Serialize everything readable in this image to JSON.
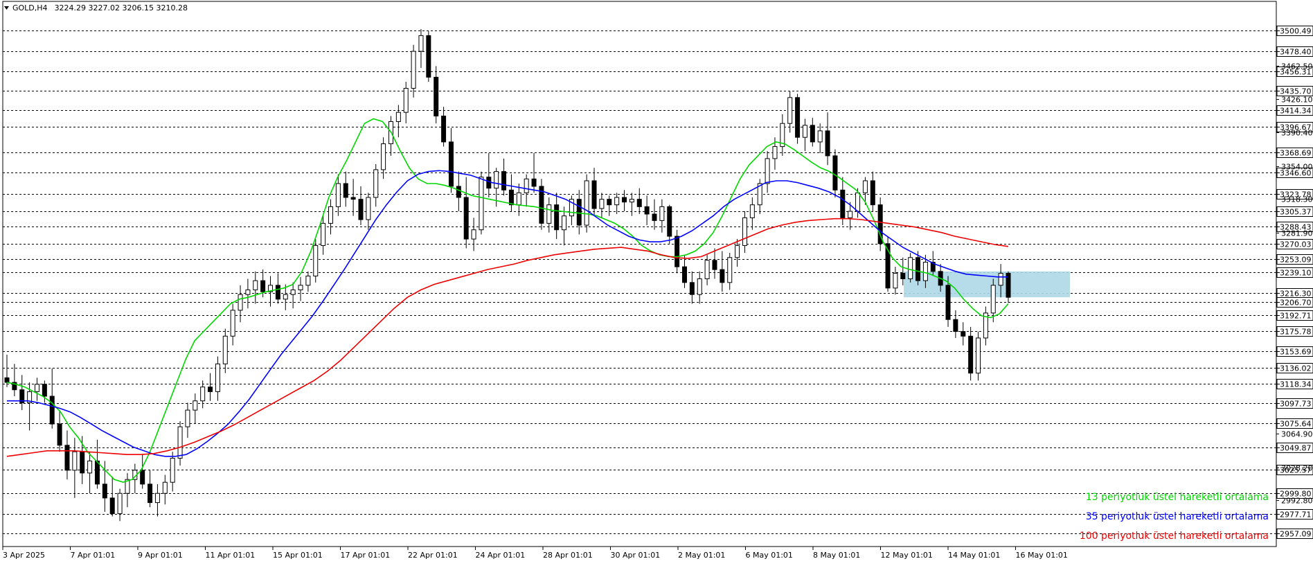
{
  "header": {
    "symbol": "GOLD,H4",
    "ohlc": "3224.29 3227.02 3206.15 3210.28"
  },
  "legend": [
    {
      "label": "13 periyotluk üstel hareketli ortalama",
      "color": "#00d800"
    },
    {
      "label": "35 periyotluk üstel hareketli ortalama",
      "color": "#0000ff"
    },
    {
      "label": "100 periyotluk üstel hareketli ortalama",
      "color": "#ee0000"
    }
  ],
  "price_axis": {
    "level_labels": [
      "3500.49",
      "3478.40",
      "3456.31",
      "3435.70",
      "3414.34",
      "3396.67",
      "3368.69",
      "3346.60",
      "3323.78",
      "3305.37",
      "3288.43",
      "3270.03",
      "3253.09",
      "3239.10",
      "3216.30",
      "3206.70",
      "3192.71",
      "3175.78",
      "3153.69",
      "3136.02",
      "3118.34",
      "3097.73",
      "3075.64",
      "3049.87",
      "3025.57",
      "2999.80",
      "2977.71",
      "2957.09"
    ],
    "tick_labels": [
      "3462.50",
      "3426.10",
      "3390.40",
      "3354.00",
      "3318.30",
      "3281.90",
      "3064.90",
      "3028.20",
      "2992.80"
    ]
  },
  "time_axis": {
    "labels": [
      "3 Apr 2025",
      "7 Apr 01:01",
      "9 Apr 01:01",
      "11 Apr 01:01",
      "15 Apr 01:01",
      "17 Apr 01:01",
      "22 Apr 01:01",
      "24 Apr 01:01",
      "28 Apr 01:01",
      "30 Apr 01:01",
      "2 May 01:01",
      "6 May 01:01",
      "8 May 01:01",
      "12 May 01:01",
      "14 May 01:01",
      "16 May 01:01"
    ]
  },
  "chart_data": {
    "type": "candlestick",
    "symbol": "GOLD",
    "timeframe": "H4",
    "ylim": [
      2950,
      3510
    ],
    "grid": "horizontal dashed lines at level labels",
    "zone": {
      "y_top": 3240,
      "y_bottom": 3212,
      "color": "#add8e6"
    },
    "x_ticks": [
      "3 Apr 2025",
      "7 Apr 01:01",
      "9 Apr 01:01",
      "11 Apr 01:01",
      "15 Apr 01:01",
      "17 Apr 01:01",
      "22 Apr 01:01",
      "24 Apr 01:01",
      "28 Apr 01:01",
      "30 Apr 01:01",
      "2 May 01:01",
      "6 May 01:01",
      "8 May 01:01",
      "12 May 01:01",
      "14 May 01:01",
      "16 May 01:01"
    ],
    "candles": [
      [
        3125,
        3150,
        3115,
        3120
      ],
      [
        3120,
        3140,
        3105,
        3112
      ],
      [
        3112,
        3128,
        3090,
        3098
      ],
      [
        3098,
        3120,
        3068,
        3110
      ],
      [
        3110,
        3125,
        3100,
        3118
      ],
      [
        3118,
        3122,
        3098,
        3105
      ],
      [
        3105,
        3135,
        3070,
        3075
      ],
      [
        3075,
        3090,
        3045,
        3052
      ],
      [
        3052,
        3068,
        3015,
        3025
      ],
      [
        3025,
        3060,
        2995,
        3045
      ],
      [
        3045,
        3062,
        3010,
        3022
      ],
      [
        3022,
        3045,
        3000,
        3035
      ],
      [
        3035,
        3058,
        3005,
        3010
      ],
      [
        3010,
        3035,
        2980,
        2995
      ],
      [
        2995,
        3018,
        2975,
        2978
      ],
      [
        2978,
        3005,
        2970,
        3000
      ],
      [
        3000,
        3022,
        2985,
        3015
      ],
      [
        3015,
        3032,
        3000,
        3025
      ],
      [
        3025,
        3042,
        3005,
        3010
      ],
      [
        3010,
        3025,
        2985,
        2990
      ],
      [
        2990,
        3010,
        2975,
        3000
      ],
      [
        3000,
        3020,
        2988,
        3012
      ],
      [
        3012,
        3045,
        3002,
        3038
      ],
      [
        3038,
        3078,
        3030,
        3072
      ],
      [
        3072,
        3098,
        3060,
        3090
      ],
      [
        3090,
        3108,
        3075,
        3100
      ],
      [
        3100,
        3122,
        3092,
        3115
      ],
      [
        3115,
        3130,
        3100,
        3110
      ],
      [
        3110,
        3148,
        3100,
        3140
      ],
      [
        3140,
        3178,
        3130,
        3170
      ],
      [
        3170,
        3205,
        3160,
        3198
      ],
      [
        3198,
        3225,
        3185,
        3215
      ],
      [
        3215,
        3232,
        3200,
        3220
      ],
      [
        3220,
        3240,
        3205,
        3230
      ],
      [
        3230,
        3242,
        3212,
        3218
      ],
      [
        3218,
        3235,
        3202,
        3225
      ],
      [
        3225,
        3238,
        3205,
        3210
      ],
      [
        3210,
        3226,
        3198,
        3215
      ],
      [
        3215,
        3228,
        3200,
        3220
      ],
      [
        3220,
        3234,
        3208,
        3225
      ],
      [
        3225,
        3240,
        3218,
        3235
      ],
      [
        3235,
        3275,
        3228,
        3268
      ],
      [
        3268,
        3300,
        3258,
        3292
      ],
      [
        3292,
        3318,
        3280,
        3310
      ],
      [
        3310,
        3345,
        3300,
        3335
      ],
      [
        3335,
        3348,
        3310,
        3320
      ],
      [
        3320,
        3340,
        3300,
        3318
      ],
      [
        3318,
        3332,
        3290,
        3296
      ],
      [
        3296,
        3325,
        3285,
        3320
      ],
      [
        3320,
        3356,
        3310,
        3350
      ],
      [
        3350,
        3385,
        3340,
        3378
      ],
      [
        3378,
        3408,
        3365,
        3402
      ],
      [
        3402,
        3420,
        3385,
        3412
      ],
      [
        3412,
        3445,
        3400,
        3438
      ],
      [
        3438,
        3485,
        3428,
        3478
      ],
      [
        3478,
        3502,
        3460,
        3495
      ],
      [
        3495,
        3500,
        3445,
        3450
      ],
      [
        3450,
        3462,
        3400,
        3408
      ],
      [
        3408,
        3418,
        3375,
        3380
      ],
      [
        3380,
        3395,
        3325,
        3332
      ],
      [
        3332,
        3348,
        3305,
        3320
      ],
      [
        3320,
        3342,
        3265,
        3275
      ],
      [
        3275,
        3298,
        3262,
        3285
      ],
      [
        3285,
        3348,
        3280,
        3342
      ],
      [
        3342,
        3368,
        3320,
        3330
      ],
      [
        3330,
        3352,
        3310,
        3348
      ],
      [
        3348,
        3362,
        3322,
        3328
      ],
      [
        3328,
        3345,
        3305,
        3312
      ],
      [
        3312,
        3335,
        3300,
        3325
      ],
      [
        3325,
        3345,
        3310,
        3340
      ],
      [
        3340,
        3368,
        3325,
        3332
      ],
      [
        3332,
        3340,
        3285,
        3292
      ],
      [
        3292,
        3320,
        3282,
        3312
      ],
      [
        3312,
        3325,
        3275,
        3285
      ],
      [
        3285,
        3310,
        3268,
        3300
      ],
      [
        3300,
        3322,
        3290,
        3318
      ],
      [
        3318,
        3328,
        3280,
        3290
      ],
      [
        3290,
        3345,
        3282,
        3338
      ],
      [
        3338,
        3352,
        3300,
        3308
      ],
      [
        3308,
        3325,
        3298,
        3318
      ],
      [
        3318,
        3322,
        3300,
        3312
      ],
      [
        3312,
        3325,
        3302,
        3320
      ],
      [
        3320,
        3328,
        3305,
        3315
      ],
      [
        3315,
        3325,
        3300,
        3318
      ],
      [
        3318,
        3330,
        3302,
        3310
      ],
      [
        3310,
        3322,
        3290,
        3302
      ],
      [
        3302,
        3318,
        3285,
        3295
      ],
      [
        3295,
        3318,
        3282,
        3310
      ],
      [
        3310,
        3312,
        3270,
        3278
      ],
      [
        3278,
        3285,
        3238,
        3245
      ],
      [
        3245,
        3258,
        3222,
        3228
      ],
      [
        3228,
        3240,
        3205,
        3215
      ],
      [
        3215,
        3240,
        3205,
        3232
      ],
      [
        3232,
        3258,
        3225,
        3252
      ],
      [
        3252,
        3265,
        3232,
        3242
      ],
      [
        3242,
        3262,
        3218,
        3228
      ],
      [
        3228,
        3260,
        3220,
        3255
      ],
      [
        3255,
        3275,
        3245,
        3268
      ],
      [
        3268,
        3305,
        3260,
        3298
      ],
      [
        3298,
        3320,
        3285,
        3312
      ],
      [
        3312,
        3340,
        3302,
        3335
      ],
      [
        3335,
        3370,
        3325,
        3362
      ],
      [
        3362,
        3385,
        3350,
        3375
      ],
      [
        3375,
        3410,
        3365,
        3400
      ],
      [
        3400,
        3435,
        3390,
        3428
      ],
      [
        3428,
        3432,
        3378,
        3385
      ],
      [
        3385,
        3405,
        3370,
        3398
      ],
      [
        3398,
        3406,
        3375,
        3380
      ],
      [
        3380,
        3400,
        3368,
        3392
      ],
      [
        3392,
        3412,
        3355,
        3365
      ],
      [
        3365,
        3372,
        3320,
        3328
      ],
      [
        3328,
        3342,
        3290,
        3298
      ],
      [
        3298,
        3315,
        3285,
        3305
      ],
      [
        3305,
        3330,
        3298,
        3325
      ],
      [
        3325,
        3342,
        3312,
        3338
      ],
      [
        3338,
        3348,
        3305,
        3312
      ],
      [
        3312,
        3320,
        3262,
        3270
      ],
      [
        3270,
        3278,
        3218,
        3222
      ],
      [
        3222,
        3245,
        3215,
        3238
      ],
      [
        3238,
        3255,
        3225,
        3232
      ],
      [
        3232,
        3260,
        3228,
        3255
      ],
      [
        3255,
        3262,
        3225,
        3230
      ],
      [
        3230,
        3258,
        3222,
        3250
      ],
      [
        3250,
        3262,
        3235,
        3240
      ],
      [
        3240,
        3248,
        3218,
        3225
      ],
      [
        3225,
        3235,
        3180,
        3188
      ],
      [
        3188,
        3198,
        3168,
        3175
      ],
      [
        3175,
        3185,
        3160,
        3170
      ],
      [
        3170,
        3180,
        3122,
        3130
      ],
      [
        3130,
        3175,
        3122,
        3168
      ],
      [
        3168,
        3202,
        3160,
        3195
      ],
      [
        3195,
        3232,
        3185,
        3225
      ],
      [
        3225,
        3248,
        3212,
        3238
      ],
      [
        3238,
        3240,
        3206,
        3212
      ]
    ],
    "series": [
      {
        "name": "13 periyotluk üstel hareketli ortalama",
        "color": "#00d800",
        "values": [
          3120,
          3118,
          3115,
          3110,
          3105,
          3098,
          3088,
          3072,
          3060,
          3045,
          3035,
          3025,
          3015,
          3012,
          3015,
          3025,
          3045,
          3070,
          3095,
          3120,
          3145,
          3165,
          3175,
          3185,
          3195,
          3205,
          3210,
          3212,
          3215,
          3218,
          3220,
          3222,
          3226,
          3240,
          3262,
          3290,
          3320,
          3342,
          3360,
          3380,
          3400,
          3405,
          3402,
          3390,
          3370,
          3352,
          3340,
          3335,
          3335,
          3333,
          3330,
          3326,
          3322,
          3320,
          3318,
          3316,
          3314,
          3312,
          3311,
          3310,
          3308,
          3306,
          3305,
          3304,
          3303,
          3302,
          3300,
          3296,
          3292,
          3286,
          3278,
          3268,
          3262,
          3258,
          3256,
          3256,
          3258,
          3262,
          3270,
          3282,
          3300,
          3320,
          3340,
          3355,
          3365,
          3375,
          3380,
          3378,
          3372,
          3365,
          3358,
          3352,
          3348,
          3342,
          3335,
          3328,
          3315,
          3295,
          3272,
          3255,
          3245,
          3242,
          3240,
          3238,
          3234,
          3230,
          3222,
          3210,
          3200,
          3192,
          3190,
          3194,
          3205
        ]
      },
      {
        "name": "35 periyotluk üstel hareketli ortalama",
        "color": "#0000ff",
        "values": [
          3100,
          3100,
          3100,
          3098,
          3095,
          3092,
          3088,
          3082,
          3075,
          3068,
          3062,
          3056,
          3050,
          3046,
          3042,
          3040,
          3040,
          3042,
          3048,
          3056,
          3065,
          3075,
          3088,
          3102,
          3118,
          3134,
          3150,
          3164,
          3178,
          3192,
          3208,
          3225,
          3242,
          3260,
          3278,
          3296,
          3312,
          3326,
          3338,
          3345,
          3348,
          3349,
          3348,
          3346,
          3344,
          3340,
          3336,
          3334,
          3332,
          3330,
          3328,
          3326,
          3322,
          3318,
          3312,
          3306,
          3298,
          3290,
          3284,
          3278,
          3274,
          3272,
          3272,
          3274,
          3278,
          3284,
          3292,
          3300,
          3310,
          3318,
          3324,
          3330,
          3336,
          3338,
          3338,
          3336,
          3333,
          3330,
          3326,
          3320,
          3312,
          3302,
          3292,
          3282,
          3274,
          3266,
          3260,
          3254,
          3248,
          3244,
          3240,
          3237,
          3236,
          3235,
          3234,
          3234
        ]
      },
      {
        "name": "100 periyotluk üstel hareketli ortalama",
        "color": "#ee0000",
        "values": [
          3040,
          3042,
          3044,
          3046,
          3046,
          3046,
          3045,
          3044,
          3043,
          3042,
          3042,
          3043,
          3046,
          3050,
          3055,
          3061,
          3067,
          3074,
          3082,
          3090,
          3098,
          3106,
          3114,
          3122,
          3132,
          3144,
          3158,
          3172,
          3186,
          3200,
          3212,
          3220,
          3226,
          3230,
          3234,
          3238,
          3242,
          3245,
          3248,
          3252,
          3255,
          3258,
          3260,
          3262,
          3264,
          3265,
          3266,
          3264,
          3262,
          3258,
          3255,
          3254,
          3256,
          3262,
          3268,
          3274,
          3280,
          3286,
          3290,
          3293,
          3295,
          3296,
          3297,
          3297,
          3296,
          3294,
          3292,
          3290,
          3288,
          3285,
          3282,
          3278,
          3275,
          3272,
          3269,
          3267
        ]
      }
    ]
  }
}
